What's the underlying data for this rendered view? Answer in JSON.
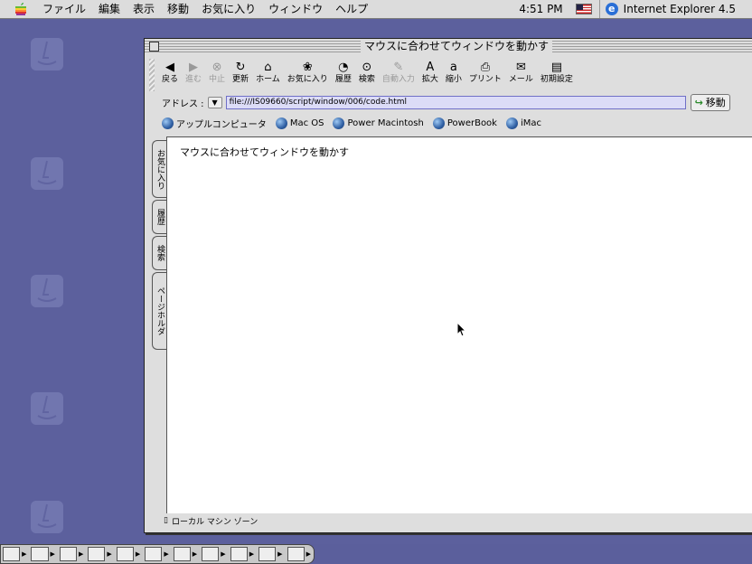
{
  "menubar": {
    "items": [
      "ファイル",
      "編集",
      "表示",
      "移動",
      "お気に入り",
      "ウィンドウ",
      "ヘルプ"
    ],
    "clock": "4:51 PM",
    "app_name": "Internet Explorer 4.5"
  },
  "window": {
    "title": "マウスに合わせてウィンドウを動かす",
    "toolbar": [
      {
        "label": "戻る",
        "icon": "back-arrow-icon",
        "glyph": "◀",
        "enabled": true
      },
      {
        "label": "進む",
        "icon": "forward-arrow-icon",
        "glyph": "▶",
        "enabled": false
      },
      {
        "label": "中止",
        "icon": "stop-icon",
        "glyph": "⊗",
        "enabled": false
      },
      {
        "label": "更新",
        "icon": "refresh-icon",
        "glyph": "↻",
        "enabled": true
      },
      {
        "label": "ホーム",
        "icon": "home-icon",
        "glyph": "⌂",
        "enabled": true
      },
      {
        "label": "お気に入り",
        "icon": "favorites-icon",
        "glyph": "❀",
        "enabled": true
      },
      {
        "label": "履歴",
        "icon": "history-icon",
        "glyph": "◔",
        "enabled": true
      },
      {
        "label": "検索",
        "icon": "search-icon",
        "glyph": "⊙",
        "enabled": true
      },
      {
        "label": "自動入力",
        "icon": "autofill-icon",
        "glyph": "✎",
        "enabled": false
      },
      {
        "label": "拡大",
        "icon": "larger-text-icon",
        "glyph": "A",
        "enabled": true
      },
      {
        "label": "縮小",
        "icon": "smaller-text-icon",
        "glyph": "a",
        "enabled": true
      },
      {
        "label": "プリント",
        "icon": "print-icon",
        "glyph": "⎙",
        "enabled": true
      },
      {
        "label": "メール",
        "icon": "mail-icon",
        "glyph": "✉",
        "enabled": true
      },
      {
        "label": "初期設定",
        "icon": "preferences-icon",
        "glyph": "▤",
        "enabled": true
      }
    ],
    "address": {
      "label": "アドレス :",
      "value": "file:///IS09660/script/window/006/code.html",
      "go_label": "移動"
    },
    "favorites": [
      "アップルコンピュータ",
      "Mac OS",
      "Power Macintosh",
      "PowerBook",
      "iMac"
    ],
    "side_tabs": [
      "お気に入り",
      "履歴",
      "検索",
      "ページホルダ"
    ],
    "page_text": "マウスに合わせてウィンドウを動かす",
    "status": "ローカル マシン ゾーン"
  },
  "control_strip": [
    "strip-toggle",
    "monitor",
    "cd",
    "sound",
    "remote",
    "colors",
    "pattern",
    "disc",
    "file-sharing",
    "printer",
    "arrow"
  ]
}
